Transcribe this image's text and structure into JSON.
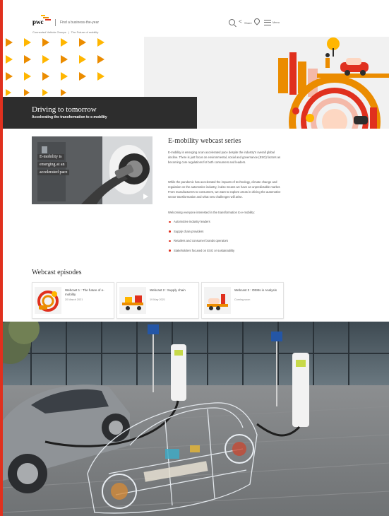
{
  "header": {
    "logo_text": "pwc",
    "site_name": "Find a business-the-year",
    "share_label": "Share",
    "menu_label": "Menu",
    "breadcrumb": [
      "Connected Vehicle Groups",
      "The Future of mobility"
    ]
  },
  "hero": {
    "title": "Driving to tomorrow",
    "subtitle": "Accelerating the transformation to e-mobility"
  },
  "intro": {
    "video_caption": [
      "E-mobility is",
      "emerging at an",
      "accelerated pace"
    ],
    "heading": "E-mobility webcast series",
    "paragraphs": [
      "E-mobility is emerging at an accelerated pace despite the industry's overall global decline. There is just focus on environmental, social and governance (ESG) factors as becoming core regulations for both consumers and leaders.",
      "While the pandemic has accelerated the impacts of technology, climate change and regulation on the automotive industry, it also means we have an unpredictable market. From manufacturers to consumers, we want to explore areas in driving the automotive sector transformation and what new challenges will arise.",
      "Welcoming everyone interested in the transformation to e-mobility:"
    ],
    "bullets": [
      "Automotive industry leaders",
      "Supply chain providers",
      "Retailers and consumer brands operators",
      "Stakeholders focused on ESG or sustainability"
    ]
  },
  "episodes": {
    "heading": "Webcast episodes",
    "items": [
      {
        "title": "Webcast 1 : The future of e-mobility",
        "date": "20 March 2021"
      },
      {
        "title": "Webcast 2 : Supply chain",
        "date": "19 May 2021"
      },
      {
        "title": "Webcast 3 : OEMs in Analysis",
        "date": "Coming soon"
      }
    ]
  },
  "colors": {
    "brand": "#e0301e",
    "accent_orange": "#eb8c00",
    "accent_yellow": "#ffb600",
    "dark_band": "#2d2d2d"
  }
}
